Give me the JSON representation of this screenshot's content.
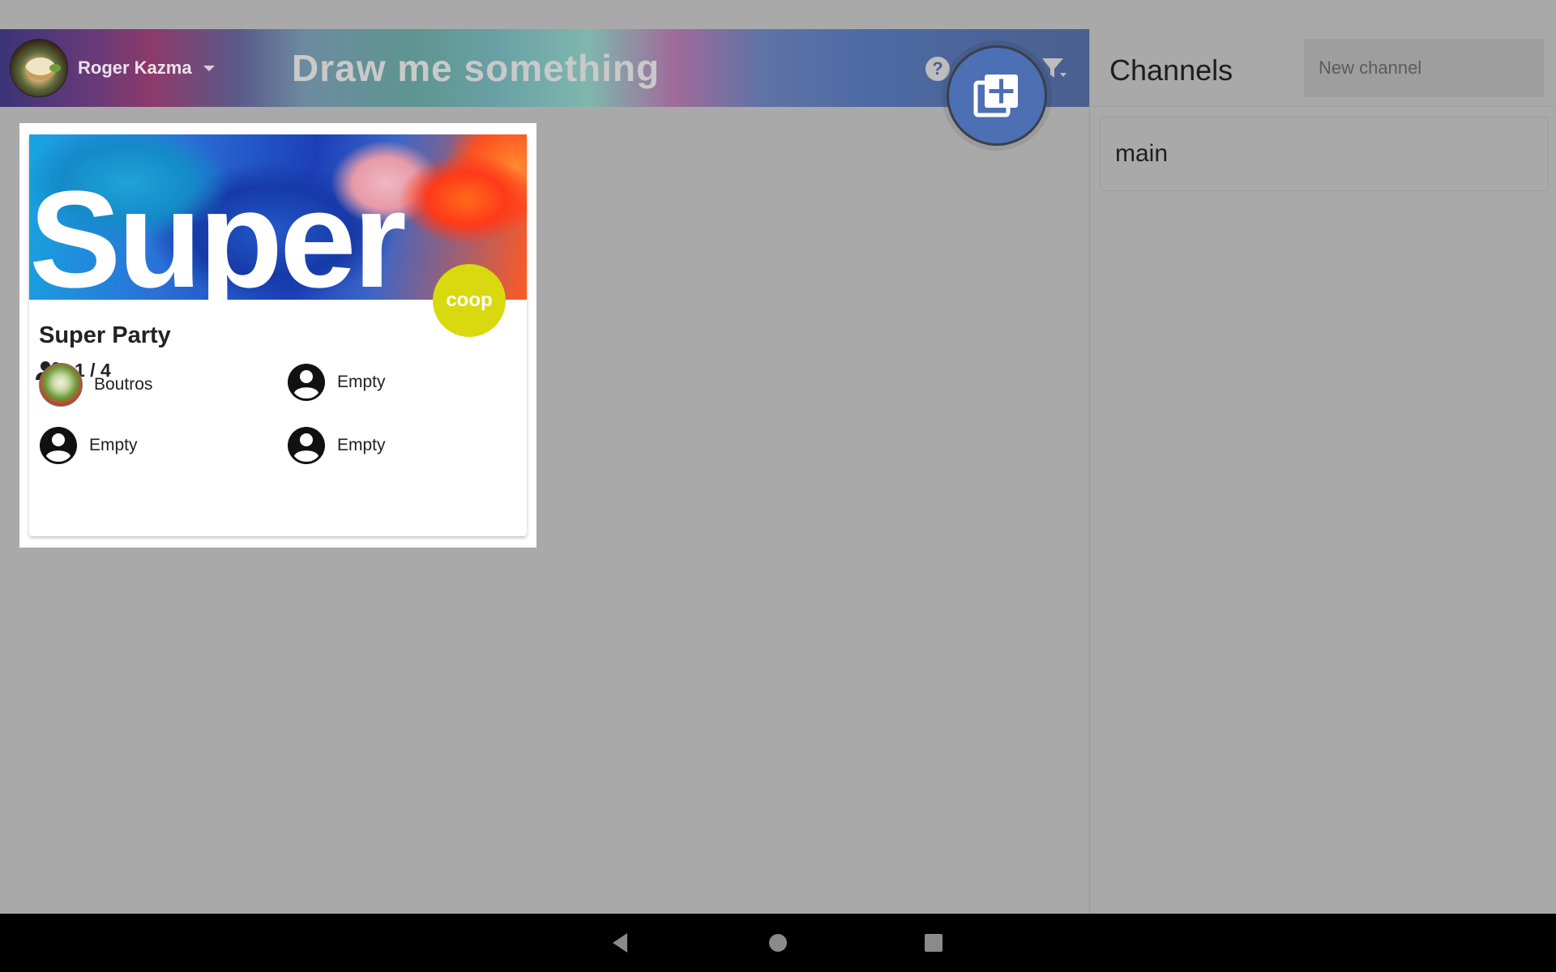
{
  "header": {
    "user_name": "Roger Kazma",
    "app_title": "Draw me something",
    "icons": [
      "help-icon",
      "filter-icon",
      "add-room-icon"
    ]
  },
  "channels": {
    "title": "Channels",
    "new_channel_placeholder": "New channel",
    "items": [
      {
        "label": "main"
      }
    ]
  },
  "room": {
    "banner_text": "Super",
    "mode_badge": "coop",
    "title": "Super Party",
    "players": "1 / 4",
    "seats": [
      {
        "name": "Boutros",
        "has_avatar": true
      },
      {
        "name": "Empty",
        "has_avatar": false
      },
      {
        "name": "Empty",
        "has_avatar": false
      },
      {
        "name": "Empty",
        "has_avatar": false
      }
    ]
  },
  "navbar": {
    "buttons": [
      "back-icon",
      "home-icon",
      "recents-icon"
    ]
  },
  "colors": {
    "fab": "#4d6fb3",
    "coop_badge": "#d9d90f",
    "background": "#a9a9a9"
  }
}
